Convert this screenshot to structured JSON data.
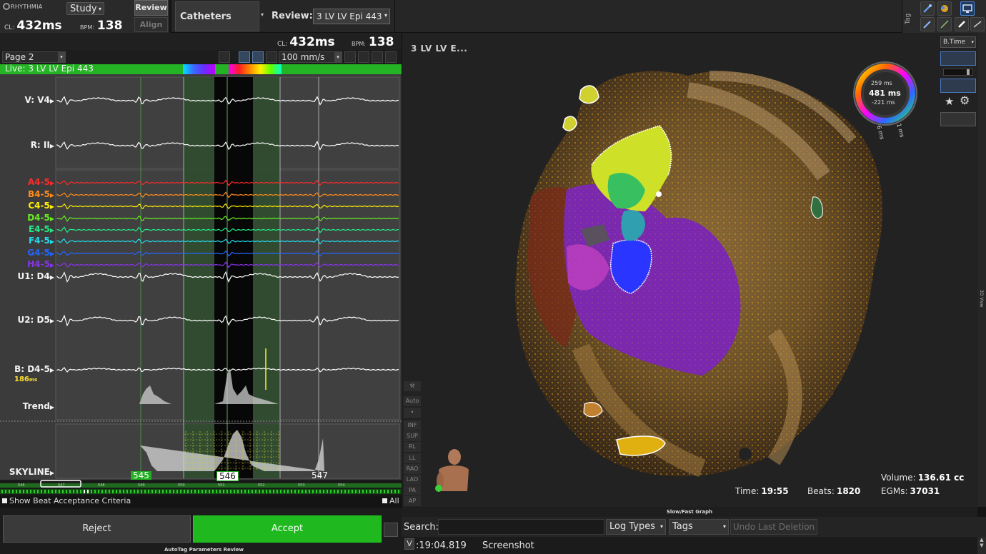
{
  "app": {
    "logo": "RHYTHMIA",
    "study_label": "Study",
    "review_tab": "Review",
    "align_tab": "Align"
  },
  "header_metrics": {
    "cl_label": "CL:",
    "cl_value": "432ms",
    "bpm_label": "BPM:",
    "bpm_value": "138"
  },
  "toolbar": {
    "catheters_label": "Catheters",
    "review_label": "Review:",
    "review_value": "3 LV LV Epi 443",
    "tag_label": "Tag"
  },
  "ekg": {
    "page": "Page 2",
    "speed": "100 mm/s",
    "live_label": "Live: 3 LV LV Epi 443",
    "channels": [
      {
        "name": "V: V4",
        "color": "#ffffff"
      },
      {
        "name": "R: II",
        "color": "#ffffff"
      },
      {
        "name": "A4-5",
        "color": "#ff2a2a"
      },
      {
        "name": "B4-5",
        "color": "#ff8c1a"
      },
      {
        "name": "C4-5",
        "color": "#ffee00"
      },
      {
        "name": "D4-5",
        "color": "#66ee22"
      },
      {
        "name": "E4-5",
        "color": "#22ee88"
      },
      {
        "name": "F4-5",
        "color": "#22ddee"
      },
      {
        "name": "G4-5",
        "color": "#2266ff"
      },
      {
        "name": "H4-5",
        "color": "#8833ee"
      },
      {
        "name": "U1: D4",
        "color": "#ffffff"
      },
      {
        "name": "U2: D5",
        "color": "#ffffff"
      },
      {
        "name": "B: D4-5",
        "color": "#ffffff"
      },
      {
        "name": "Trend",
        "color": "#ffffff"
      },
      {
        "name": "SKYLINE",
        "color": "#ffffff"
      }
    ],
    "b_duration": "186",
    "b_duration_unit": "ms",
    "beats": [
      "545",
      "546",
      "547"
    ],
    "beat_ticks": [
      "546",
      "547",
      "548",
      "549",
      "550",
      "551",
      "552",
      "553",
      "554"
    ],
    "show_beat_criteria": "Show Beat Acceptance Criteria",
    "all_label": "All"
  },
  "actions": {
    "reject": "Reject",
    "accept": "Accept",
    "autotag": "AutoTag Parameters Review"
  },
  "view3d": {
    "title": "3 LV LV E...",
    "btime": "B.Time",
    "auto_label": "Auto",
    "views": [
      "INF",
      "SUP",
      "RL",
      "LL",
      "RAO",
      "LAO",
      "PA",
      "AP"
    ],
    "side_label": "3D View",
    "dial": {
      "top": "259 ms",
      "center": "481 ms",
      "bottom": "-221 ms",
      "left_tick": "6 ms",
      "right_tick": "1 ms"
    },
    "stats": {
      "volume_label": "Volume:",
      "volume_value": "136.61 cc",
      "time_label": "Time:",
      "time_value": "19:55",
      "beats_label": "Beats:",
      "beats_value": "1820",
      "egms_label": "EGMs:",
      "egms_value": "37031"
    }
  },
  "graph": {
    "slowfast_label": "Slow/Fast Graph"
  },
  "log": {
    "search_label": "Search:",
    "search_value": "",
    "log_types": "Log Types",
    "tags": "Tags",
    "undo": "Undo Last Deletion",
    "v_label": "V",
    "time": ":19:04.819",
    "message": "Screenshot"
  }
}
